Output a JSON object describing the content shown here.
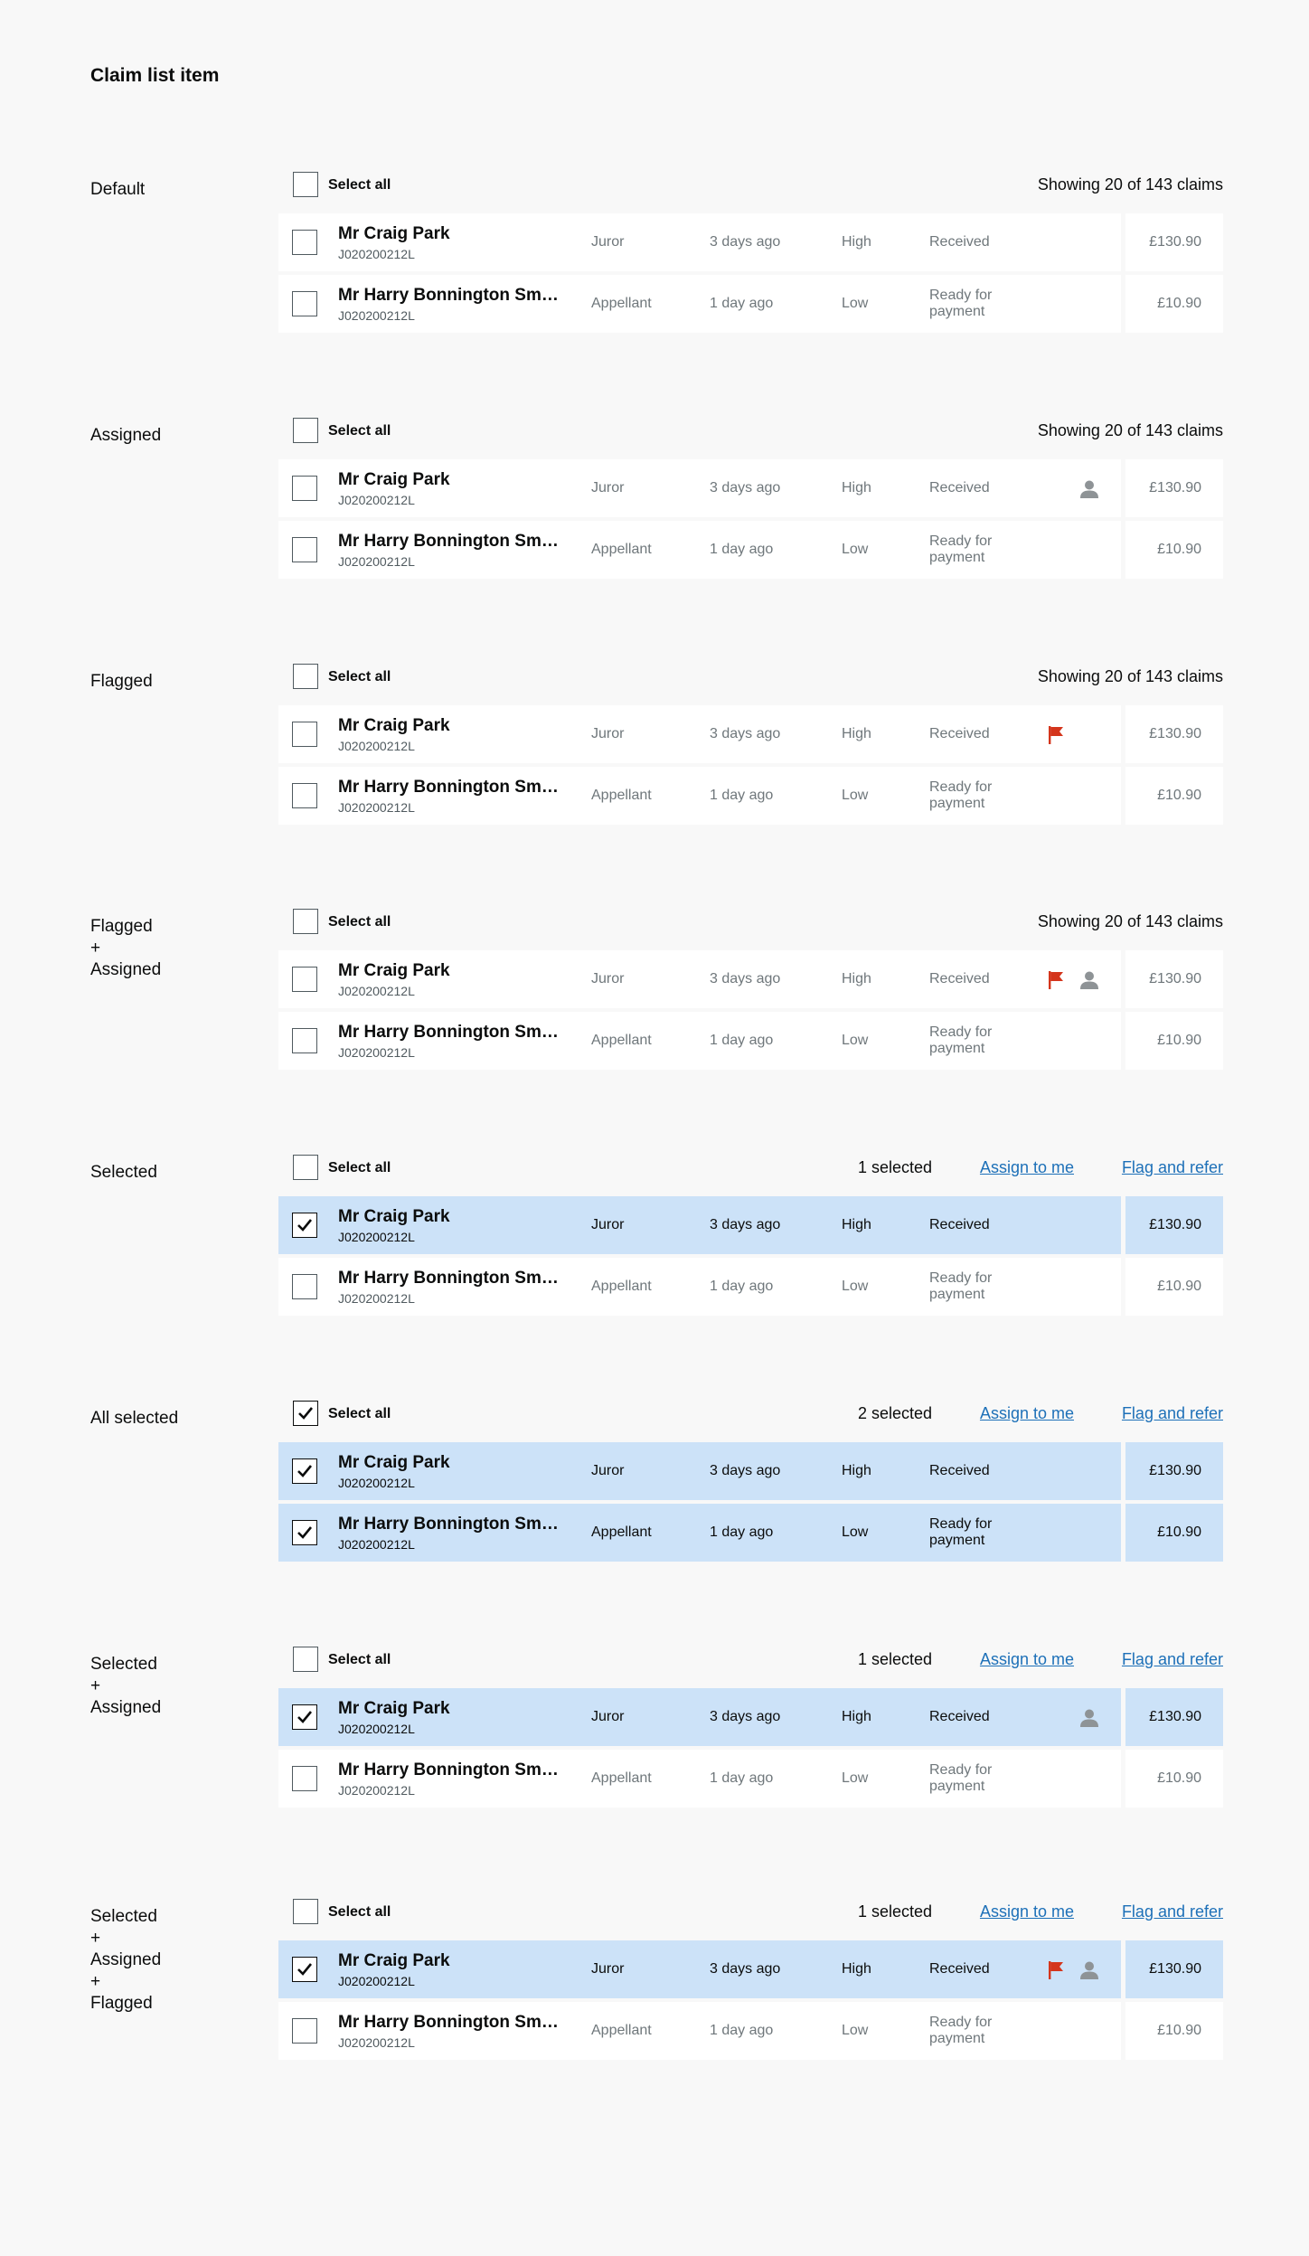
{
  "page": {
    "title": "Claim list item"
  },
  "toolbar": {
    "select_all": "Select all",
    "showing": "Showing 20 of 143 claims",
    "one_selected": "1 selected",
    "two_selected": "2 selected",
    "assign_link": "Assign to me",
    "flag_link": "Flag and refer"
  },
  "rows": [
    {
      "name": "Mr Craig Park",
      "ref": "J020200212L",
      "role": "Juror",
      "time": "3 days ago",
      "priority": "High",
      "status": "Received",
      "amount": "£130.90"
    },
    {
      "name": "Mr Harry Bonnington Smythe",
      "ref": "J020200212L",
      "role": "Appellant",
      "time": "1 day ago",
      "priority": "Low",
      "status": "Ready for payment",
      "amount": "£10.90"
    }
  ],
  "sections": [
    {
      "label": "Default"
    },
    {
      "label": "Assigned"
    },
    {
      "label": "Flagged"
    },
    {
      "label": "Flagged\n+\nAssigned"
    },
    {
      "label": "Selected"
    },
    {
      "label": "All selected"
    },
    {
      "label": "Selected\n+\nAssigned"
    },
    {
      "label": "Selected\n+\nAssigned\n+\nFlagged"
    }
  ],
  "colors": {
    "background": "#f8f8f8",
    "selected_row": "#cce2f8",
    "link": "#1d70b8",
    "flag": "#d4351c",
    "person": "#8e9396"
  },
  "icons": {
    "flag": "flag-icon",
    "assigned": "person-icon",
    "checkbox_tick": "check-icon"
  }
}
